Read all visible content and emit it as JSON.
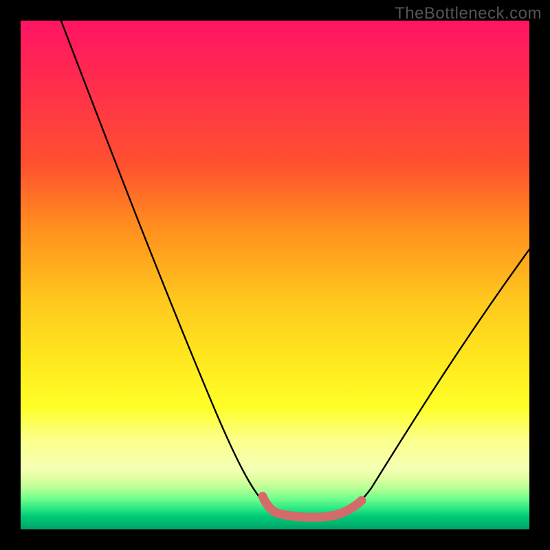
{
  "watermark": "TheBottleneck.com",
  "chart_data": {
    "type": "line",
    "title": "",
    "xlabel": "",
    "ylabel": "",
    "xlim": [
      0,
      100
    ],
    "ylim": [
      0,
      100
    ],
    "grid": false,
    "series": [
      {
        "name": "bottleneck-curve",
        "points": [
          {
            "x": 8,
            "y": 100
          },
          {
            "x": 18,
            "y": 75
          },
          {
            "x": 28,
            "y": 50
          },
          {
            "x": 38,
            "y": 25
          },
          {
            "x": 48,
            "y": 5
          },
          {
            "x": 52,
            "y": 2
          },
          {
            "x": 56,
            "y": 2
          },
          {
            "x": 60,
            "y": 2
          },
          {
            "x": 64,
            "y": 2
          },
          {
            "x": 68,
            "y": 5
          },
          {
            "x": 76,
            "y": 20
          },
          {
            "x": 84,
            "y": 35
          },
          {
            "x": 92,
            "y": 50
          },
          {
            "x": 100,
            "y": 60
          }
        ]
      },
      {
        "name": "optimal-range",
        "flat_y": 3,
        "x_start": 49,
        "x_end": 67,
        "color": "#d86a6a"
      }
    ],
    "annotations": []
  }
}
